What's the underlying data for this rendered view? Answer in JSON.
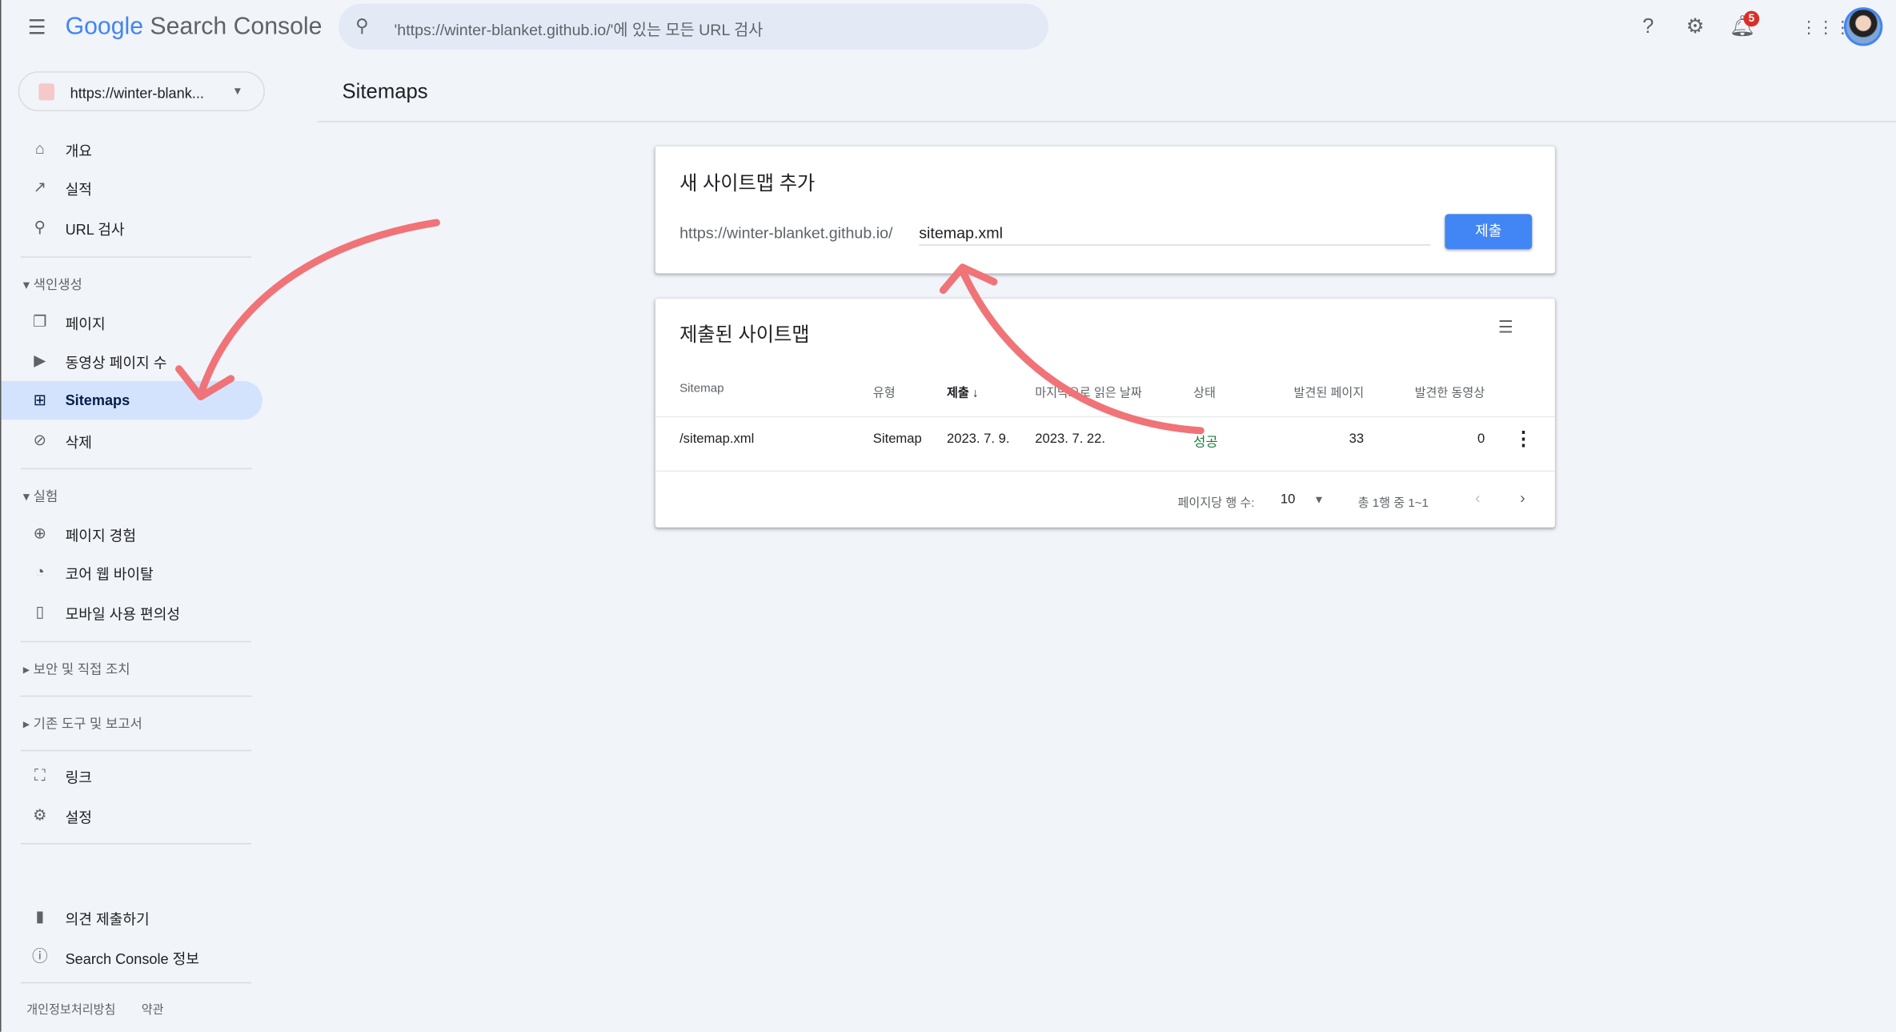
{
  "header": {
    "logo_google": "Google",
    "logo_product": "Search Console",
    "search_placeholder": "'https://winter-blanket.github.io/'에 있는 모든 URL 검사",
    "notification_count": "5"
  },
  "property": {
    "label": "https://winter-blank..."
  },
  "sidebar": {
    "items": [
      {
        "label": "개요",
        "icon": "home-icon"
      },
      {
        "label": "실적",
        "icon": "trending-up-icon"
      },
      {
        "label": "URL 검사",
        "icon": "search-icon"
      }
    ],
    "indexing": {
      "label": "색인생성",
      "items": [
        {
          "label": "페이지"
        },
        {
          "label": "동영상 페이지 수"
        },
        {
          "label": "Sitemaps",
          "active": true
        },
        {
          "label": "삭제"
        }
      ]
    },
    "experience": {
      "label": "실험",
      "items": [
        {
          "label": "페이지 경험"
        },
        {
          "label": "코어 웹 바이탈"
        },
        {
          "label": "모바일 사용 편의성"
        }
      ]
    },
    "security": {
      "label": "보안 및 직접 조치"
    },
    "legacy": {
      "label": "기존 도구 및 보고서"
    },
    "links": {
      "label": "링크"
    },
    "settings": {
      "label": "설정"
    },
    "feedback": {
      "label": "의견 제출하기"
    },
    "about": {
      "label": "Search Console 정보"
    },
    "footer": {
      "privacy": "개인정보처리방침",
      "terms": "약관"
    }
  },
  "main": {
    "title": "Sitemaps",
    "add_card": {
      "title": "새 사이트맵 추가",
      "prefix": "https://winter-blanket.github.io/",
      "input_value": "sitemap.xml",
      "submit": "제출"
    },
    "list_card": {
      "title": "제출된 사이트맵",
      "columns": [
        "Sitemap",
        "유형",
        "제출",
        "마지막으로 읽은 날짜",
        "상태",
        "발견된 페이지",
        "발견한 동영상"
      ],
      "rows": [
        {
          "sitemap": "/sitemap.xml",
          "type": "Sitemap",
          "submitted": "2023. 7. 9.",
          "last_read": "2023. 7. 22.",
          "status": "성공",
          "pages": "33",
          "videos": "0"
        }
      ],
      "rows_per_page_label": "페이지당 행 수:",
      "rows_per_page": "10",
      "range": "총 1행 중 1~1"
    },
    "status_color": "#188038",
    "accent": "#4285f4",
    "annotation_color": "#f07378"
  }
}
